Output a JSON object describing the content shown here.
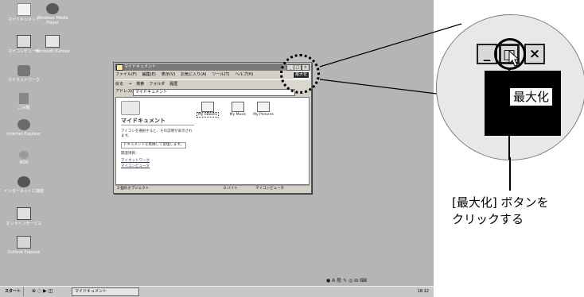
{
  "desktop": {
    "icons": [
      {
        "label": "マイドキュメント",
        "icon": "my-documents-icon"
      },
      {
        "label": "Windows Media Player",
        "icon": "media-player-icon"
      },
      {
        "label": "マイコンピュータ",
        "icon": "my-computer-icon"
      },
      {
        "label": "Microsoft Outlook",
        "icon": "outlook-icon"
      },
      {
        "label": "マイネットワーク",
        "icon": "network-icon"
      },
      {
        "label": "ごみ箱",
        "icon": "recycle-bin-icon"
      },
      {
        "label": "Internet Explorer",
        "icon": "internet-explorer-icon"
      },
      {
        "label": "MSN",
        "icon": "msn-icon"
      },
      {
        "label": "インターネットに接続",
        "icon": "connect-internet-icon"
      },
      {
        "label": "オンラインサービス",
        "icon": "online-services-icon"
      },
      {
        "label": "Outlook Express",
        "icon": "outlook-express-icon"
      }
    ]
  },
  "window": {
    "title": "マイドキュメント",
    "min_label": "_",
    "max_label": "□",
    "close_label": "×",
    "menu": [
      "ファイル(F)",
      "編集(E)",
      "表示(V)",
      "お気に入り(A)",
      "ツール(T)",
      "ヘルプ(H)"
    ],
    "toolbar": [
      "戻る",
      "→",
      "検索",
      "フォルダ",
      "履歴"
    ],
    "address_label": "アドレス(D)",
    "address_value": "マイドキュメント",
    "content_title": "マイドキュメント",
    "desc": "アイコンを選択すると、その説明が表示されます。",
    "desc2": "ドキュメントを格納して管理します。",
    "related_heading": "関連項目：",
    "related_links": [
      "マイネットワーク",
      "マイコンピュータ"
    ],
    "folders": [
      "My eBooks",
      "My Music",
      "My Pictures"
    ],
    "status_count": "3 個のオブジェクト",
    "status_size": "0 バイト",
    "status_zone": "マイコンピュータ",
    "tooltip": "最大化"
  },
  "taskbar": {
    "start_label": "スタート",
    "task_label": "マイドキュメント",
    "clock": "18:12"
  },
  "callout": {
    "min_label": "_",
    "max_label": "□",
    "close_label": "×",
    "tooltip": "最大化"
  },
  "instruction": {
    "line1": "[最大化] ボタンを",
    "line2": "クリックする"
  },
  "colors": {
    "desktop": "#b5b5b5",
    "titlebar": "#7a7a7a",
    "taskbar": "#c8c8c8"
  }
}
